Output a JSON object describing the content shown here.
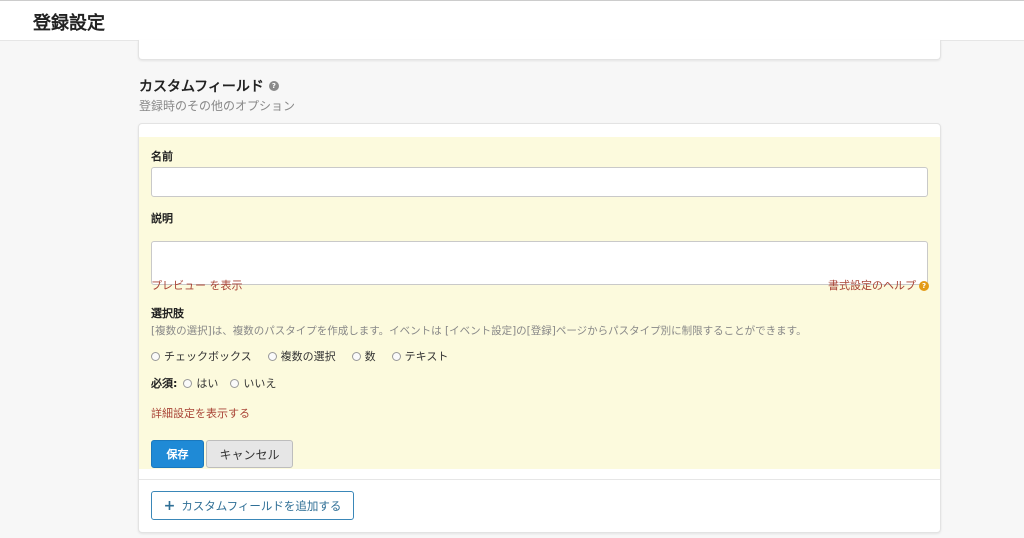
{
  "header": {
    "title": "登録設定"
  },
  "section": {
    "title": "カスタムフィールド",
    "help_icon": "question-circle-icon",
    "subtitle": "登録時のその他のオプション"
  },
  "form": {
    "name_label": "名前",
    "name_value": "",
    "description_label": "説明",
    "description_value": "",
    "preview_link": "プレビュー を表示",
    "format_help_link": "書式設定のヘルプ",
    "choices_label": "選択肢",
    "choices_hint": "[複数の選択]は、複数のパスタイプを作成します。イベントは [イベント設定]の[登録]ページからパスタイプ別に制限することができます。",
    "field_types": [
      "チェックボックス",
      "複数の選択",
      "数",
      "テキスト"
    ],
    "required_label": "必須:",
    "required_options": [
      "はい",
      "いいえ"
    ],
    "advanced_link": "詳細設定を表示する",
    "save_label": "保存",
    "cancel_label": "キャンセル"
  },
  "add_button": {
    "label": "カスタムフィールドを追加する",
    "icon": "plus-icon"
  },
  "colors": {
    "panel_bg": "#fcfadd",
    "primary": "#1f8ad6",
    "link_red": "#a94436",
    "help_orange": "#e39a17"
  }
}
